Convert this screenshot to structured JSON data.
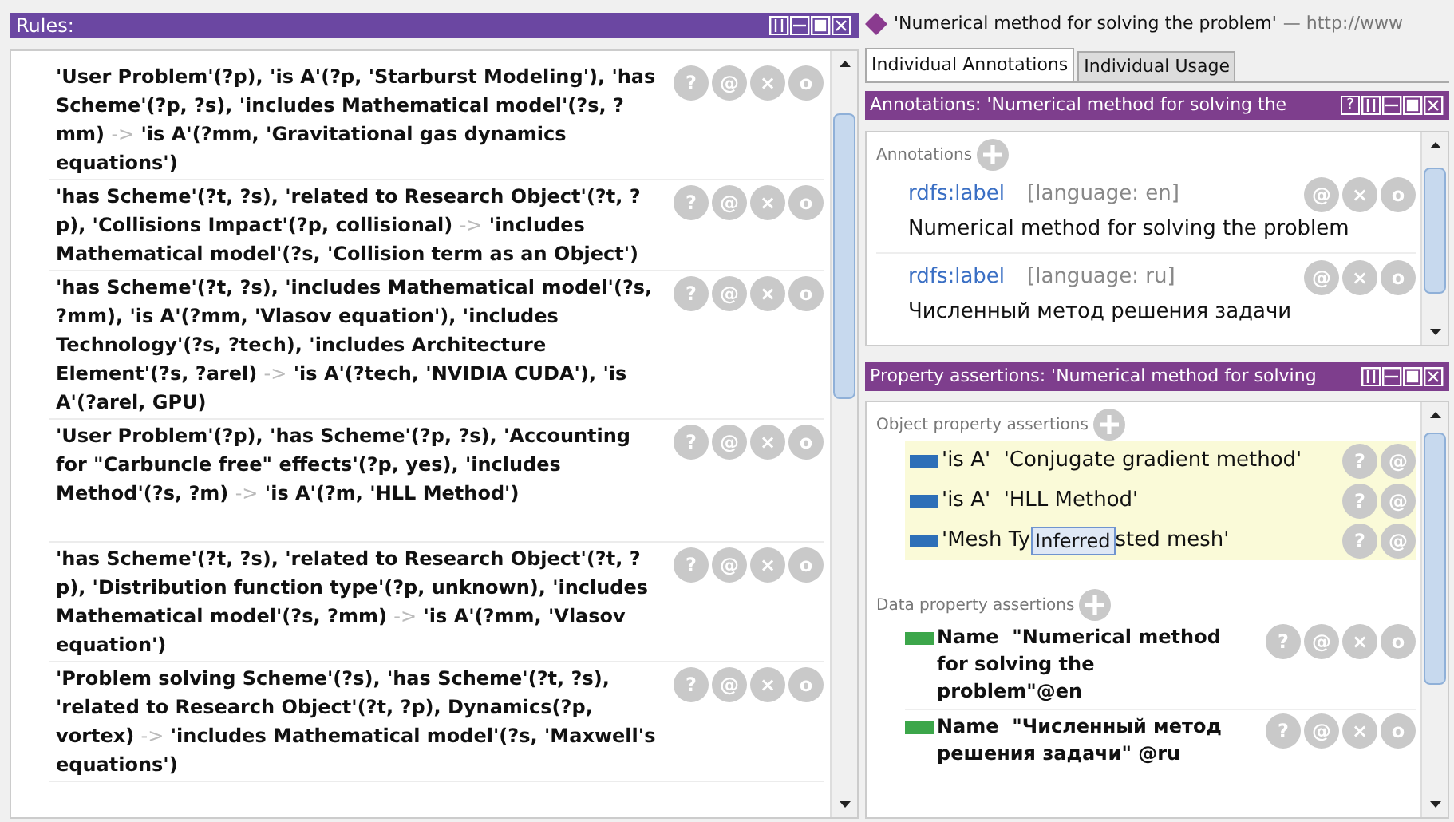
{
  "rules_panel": {
    "title": "Rules:",
    "rules": [
      {
        "premise": "'User Problem'(?p), 'is A'(?p, 'Starburst Modeling'), 'has Scheme'(?p, ?s), 'includes Mathematical model'(?s, ?mm)",
        "arrow": "->",
        "conclusion": "'is A'(?mm, 'Gravitational gas dynamics equations')",
        "actions": [
          "?",
          "@",
          "×",
          "o"
        ]
      },
      {
        "premise": "'has Scheme'(?t, ?s), 'related to Research Object'(?t, ?p), 'Collisions Impact'(?p, collisional)",
        "arrow": "->",
        "conclusion": "'includes Mathematical model'(?s, 'Collision term as an Object')",
        "actions": [
          "?",
          "@",
          "×",
          "o"
        ]
      },
      {
        "premise": "'has Scheme'(?t, ?s), 'includes Mathematical model'(?s, ?mm), 'is A'(?mm, 'Vlasov equation'), 'includes Technology'(?s, ?tech), 'includes Architecture Element'(?s, ?arel)",
        "arrow": "->",
        "conclusion": "'is A'(?tech, 'NVIDIA CUDA'), 'is A'(?arel, GPU)",
        "actions": [
          "?",
          "@",
          "×",
          "o"
        ]
      },
      {
        "premise": "'User Problem'(?p), 'has Scheme'(?p, ?s), 'Accounting for \"Carbuncle free\" effects'(?p, yes), 'includes Method'(?s, ?m)",
        "arrow": "->",
        "conclusion": "'is A'(?m, 'HLL Method')",
        "actions": [
          "?",
          "@",
          "×",
          "o"
        ]
      },
      {
        "premise": "'has Scheme'(?t, ?s), 'related to Research Object'(?t, ?p), 'Distribution function type'(?p, unknown), 'includes Mathematical model'(?s, ?mm)",
        "arrow": "->",
        "conclusion": "'is A'(?mm, 'Vlasov equation')",
        "actions": [
          "?",
          "@",
          "×",
          "o"
        ]
      },
      {
        "premise": "'Problem solving Scheme'(?s), 'has Scheme'(?t, ?s), 'related to Research Object'(?t, ?p), Dynamics(?p, vortex)",
        "arrow": "->",
        "conclusion": "'includes Mathematical model'(?s, 'Maxwell's equations')",
        "actions": [
          "?",
          "@",
          "×",
          "o"
        ]
      }
    ]
  },
  "entity": {
    "title": "'Numerical method for solving the problem'",
    "separator": "—",
    "iri": "http://www"
  },
  "tabs": [
    {
      "label": "Individual Annotations",
      "selected": true
    },
    {
      "label": "Individual Usage",
      "selected": false
    }
  ],
  "annotations_panel": {
    "title": "Annotations: 'Numerical method for solving the",
    "help": "?",
    "section": "Annotations",
    "items": [
      {
        "property": "rdfs:label",
        "language": "[language: en]",
        "value": "Numerical method for solving the problem",
        "actions": [
          "@",
          "×",
          "o"
        ]
      },
      {
        "property": "rdfs:label",
        "language": "[language: ru]",
        "value": "Численный метод решения задачи",
        "actions": [
          "@",
          "×",
          "o"
        ]
      }
    ]
  },
  "property_panel": {
    "title": "Property assertions: 'Numerical method for solving",
    "object_section": "Object property assertions",
    "object_assertions": [
      {
        "text": "'is A'  'Conjugate gradient method'",
        "actions": [
          "?",
          "@"
        ]
      },
      {
        "text": "'is A'  'HLL Method'",
        "actions": [
          "?",
          "@"
        ]
      },
      {
        "text": "'Mesh Ty",
        "tooltip": "Inferred",
        "text_after": "sted mesh'",
        "actions": [
          "?",
          "@"
        ]
      }
    ],
    "data_section": "Data property assertions",
    "data_assertions": [
      {
        "text": "Name  \"Numerical method for solving the problem\"@en",
        "actions": [
          "?",
          "@",
          "×",
          "o"
        ]
      },
      {
        "text": "Name  \"Численный метод решения задачи\" @ru",
        "actions": [
          "?",
          "@",
          "×",
          "o"
        ]
      }
    ]
  }
}
